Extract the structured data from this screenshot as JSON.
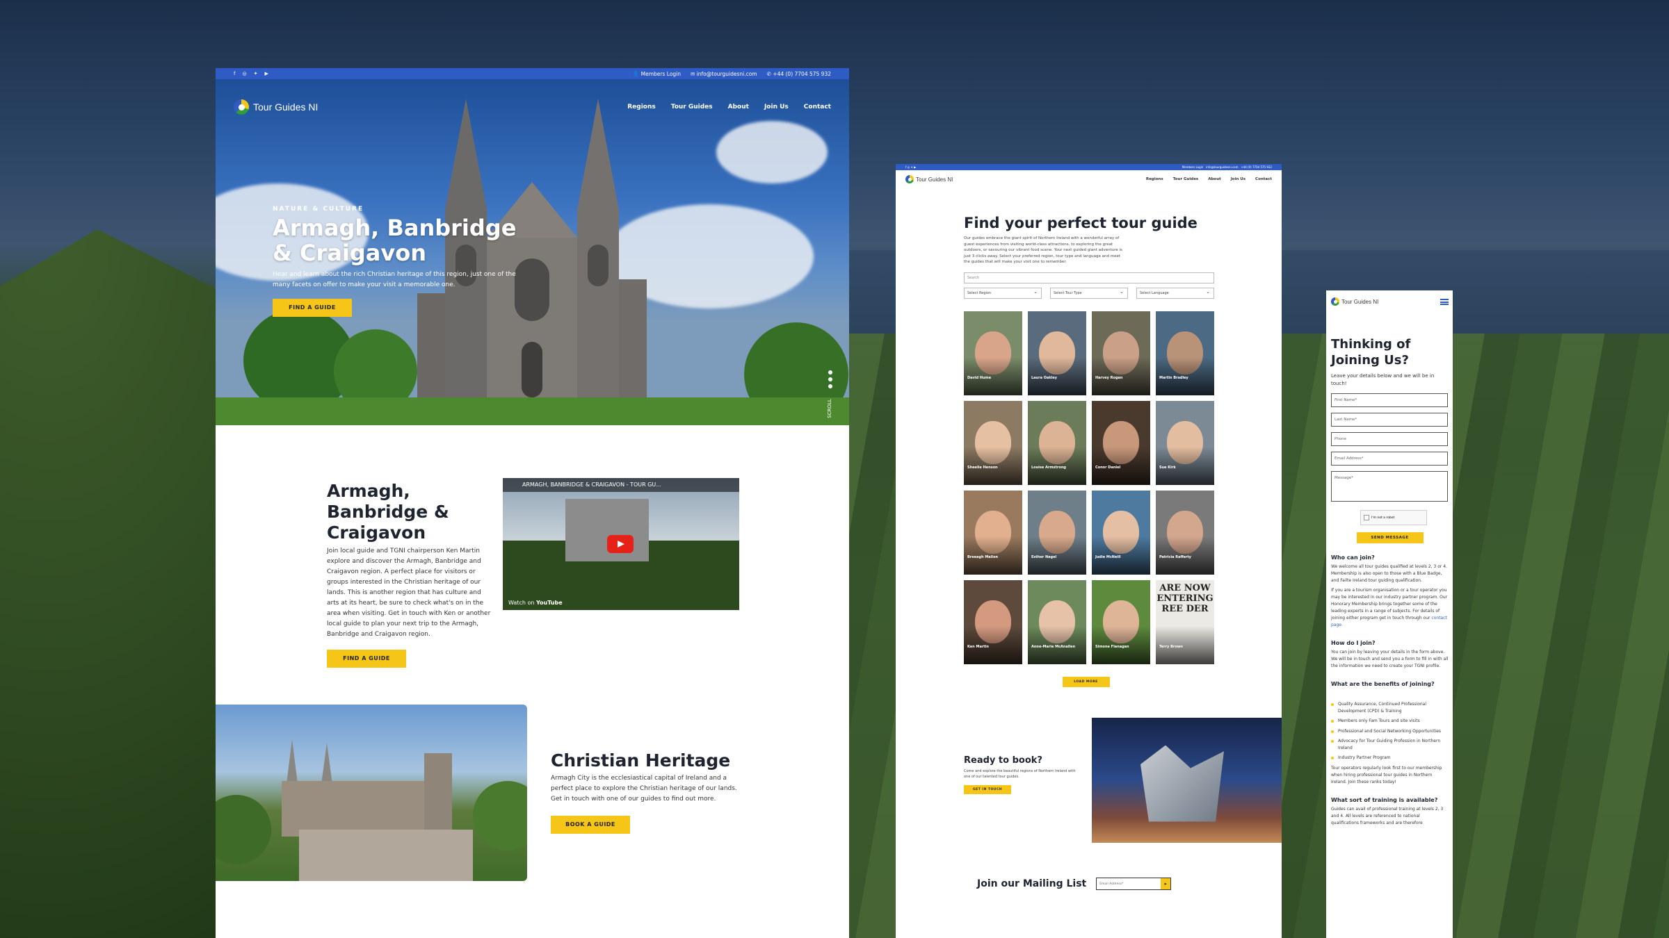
{
  "topbar": {
    "members_login": "Members Login",
    "email": "info@tourguidesni.com",
    "phone": "+44 (0) 7704 575 932"
  },
  "brand": {
    "name": "Tour Guides NI"
  },
  "nav": {
    "items": [
      "Regions",
      "Tour Guides",
      "About",
      "Join Us",
      "Contact"
    ]
  },
  "hero": {
    "eyebrow": "NATURE & CULTURE",
    "title": "Armagh, Banbridge & Craigavon",
    "subtitle": "Hear and learn about the rich Christian heritage of this region, just one of the many facets on offer to make your visit a memorable one.",
    "button": "FIND A GUIDE",
    "scroll": "SCROLL"
  },
  "intro": {
    "title": "Armagh, Banbridge & Craigavon",
    "body": "Join local guide and TGNI chairperson Ken Martin explore and discover the Armagh, Banbridge and Craigavon region. A perfect place for visitors or groups interested in the Christian heritage of our lands. This is another region that has culture and arts at its heart, be sure to check what's on in the area when visiting. Get in touch with Ken or another local guide to plan your next trip to the Armagh, Banbridge and Craigavon region.",
    "button": "FIND A GUIDE",
    "video_title": "ARMAGH, BANBRIDGE & CRAIGAVON - TOUR GU...",
    "video_watch": "Watch on",
    "video_platform": "YouTube"
  },
  "heritage": {
    "title": "Christian Heritage",
    "body": "Armagh City is the ecclesiastical capital of Ireland and a perfect place to explore the Christian heritage of our lands. Get in touch with one of our guides to find out more.",
    "button": "BOOK A GUIDE"
  },
  "guides_page": {
    "title": "Find your perfect tour guide",
    "intro": "Our guides embrace the giant spirit of Northern Ireland with a wonderful array of guest experiences from visiting world-class attractions, to exploring the great outdoors, or savouring our vibrant food scene. Your next guided giant adventure is just 3 clicks away. Select your preferred region, tour type and language and meet the guides that will make your visit one to remember.",
    "search_placeholder": "Search",
    "filters": [
      "Select Region",
      "Select Tour Type",
      "Select Language"
    ],
    "guides": [
      {
        "name": "David Hume",
        "face": "#d9a58a",
        "bg": "#7a8c6a"
      },
      {
        "name": "Laura Oakley",
        "face": "#e0b89c",
        "bg": "#5a6b7d"
      },
      {
        "name": "Harvey Rogan",
        "face": "#caa088",
        "bg": "#6e6a58"
      },
      {
        "name": "Martin Bradley",
        "face": "#b89378",
        "bg": "#4c6a84"
      },
      {
        "name": "Sheelie Henson",
        "face": "#e6c0a2",
        "bg": "#8c7a62"
      },
      {
        "name": "Louise Armstrong",
        "face": "#dcb394",
        "bg": "#6b7c5a"
      },
      {
        "name": "Conor Daniel",
        "face": "#c9977a",
        "bg": "#4a3a2e"
      },
      {
        "name": "Sue Kirk",
        "face": "#e3bd9f",
        "bg": "#7c8a96"
      },
      {
        "name": "Breeagh Mallon",
        "face": "#e2b08e",
        "bg": "#9a7a5e"
      },
      {
        "name": "Esther Nagel",
        "face": "#d8a98c",
        "bg": "#6f7f8a"
      },
      {
        "name": "Judie McNeill",
        "face": "#e4bfa4",
        "bg": "#4e7aa0"
      },
      {
        "name": "Patricia Rafferty",
        "face": "#d3a78e",
        "bg": "#7a7a7a"
      },
      {
        "name": "Ken Martin",
        "face": "#d49a80",
        "bg": "#5d4a3c"
      },
      {
        "name": "Anne-Marie McAnallen",
        "face": "#e6c2a8",
        "bg": "#6d8a5c"
      },
      {
        "name": "Simone Flanagan",
        "face": "#dfb598",
        "bg": "#5e8a3e"
      },
      {
        "name": "Terry Brown",
        "face": "#eceae4",
        "bg": "#eceae4",
        "sign": "ARE NOW ENTERING REE DER"
      }
    ],
    "load_more": "LOAD MORE"
  },
  "ready": {
    "title": "Ready to book?",
    "body": "Come and explore the beautiful regions of Northern Ireland with one of our talented tour guides.",
    "button": "GET IN TOUCH"
  },
  "mailing": {
    "title": "Join our Mailing List",
    "placeholder": "Email Address*"
  },
  "join": {
    "title": "Thinking of Joining Us?",
    "lead": "Leave your details below and we will be in touch!",
    "fields": [
      "First Name*",
      "Last Name*",
      "Phone",
      "Email Address*",
      "Message*"
    ],
    "captcha": "I'm not a robot",
    "send": "SEND MESSAGE",
    "who_title": "Who can join?",
    "who_body": "We welcome all tour guides qualified at levels 2, 3 or 4. Membership is also open to those with a Blue Badge, and Failte Ireland tour guiding qualification.",
    "who_body2": "If you are a tourism organisation or a tour operator you may be interested in our industry partner program. Our Honorary Membership brings together some of the leading experts in a range of subjects. For details of joining either program get in touch through our",
    "who_link": "contact page.",
    "how_title": "How do I join?",
    "how_body": "You can join by leaving your details in the form above. We will be in touch and send you a form to fill in with all the information we need to create your TGNI profile.",
    "benefits_title": "What are the benefits of joining?",
    "benefits": [
      "Quality Assurance, Continued Professional Development (CPD) & Training",
      "Members only Fam Tours and site visits",
      "Professional and Social Networking Opportunities",
      "Advocacy for Tour Guiding Profession in Northern Ireland",
      "Industry Partner Program"
    ],
    "operators": "Tour operators regularly look first to our membership when hiring professional tour guides in Northern Ireland. Join these ranks today!",
    "training_title": "What sort of training is available?",
    "training_body": "Guides can avail of professional training at levels 2, 3 and 4. All levels are referenced to national qualifications frameworks and are therefore"
  },
  "colors": {
    "brand_blue": "#2f5bc4",
    "accent_yellow": "#f5c518",
    "heading": "#1d2430"
  }
}
